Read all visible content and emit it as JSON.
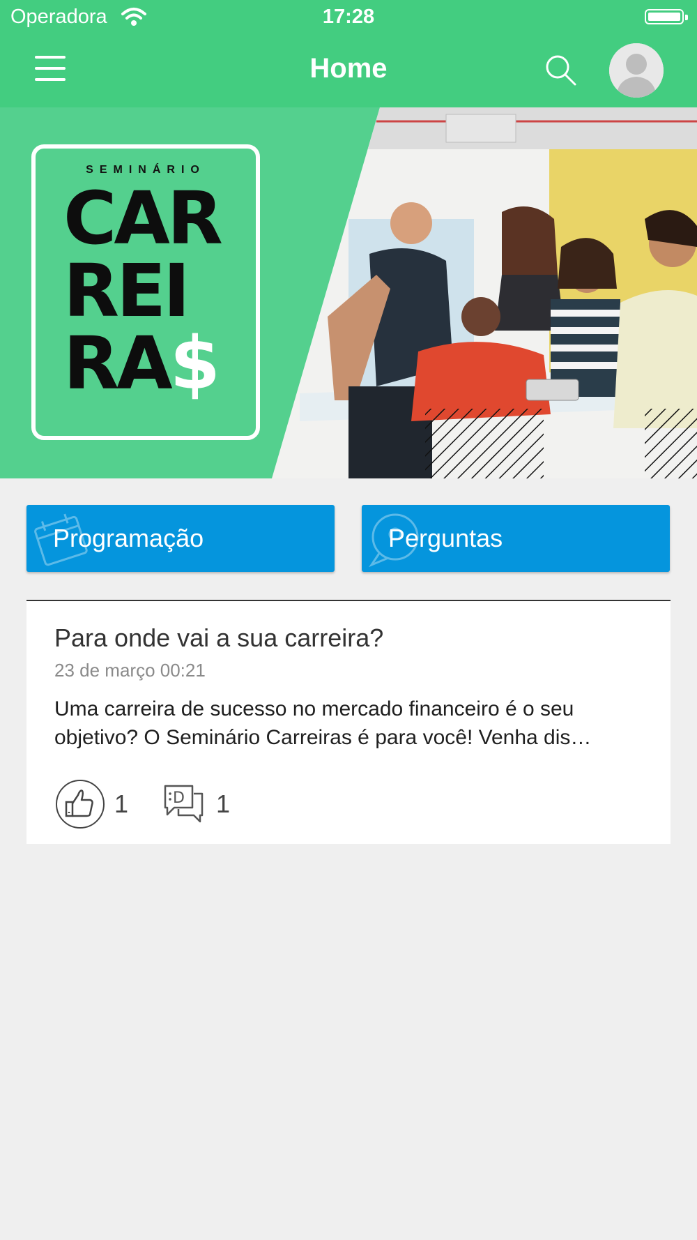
{
  "status_bar": {
    "carrier": "Operadora",
    "time": "17:28"
  },
  "header": {
    "title": "Home"
  },
  "banner": {
    "logo_small": "SEMINÁRIO",
    "logo_line1": "CAR",
    "logo_line2": "REI",
    "logo_line3": "RA",
    "logo_dollar": "$"
  },
  "actions": [
    {
      "label": "Programação",
      "icon": "calendar-icon"
    },
    {
      "label": "Perguntas",
      "icon": "speech-bubble-icon"
    }
  ],
  "post": {
    "title": "Para onde vai a sua carreira?",
    "date": "23 de março 00:21",
    "excerpt": "Uma carreira de sucesso no mercado financeiro é o seu objetivo? O Seminário Carreiras é para você! Venha dis…",
    "likes": "1",
    "comments": "1"
  },
  "colors": {
    "accent": "#43cd80",
    "button": "#0595dd",
    "background": "#efefef"
  }
}
